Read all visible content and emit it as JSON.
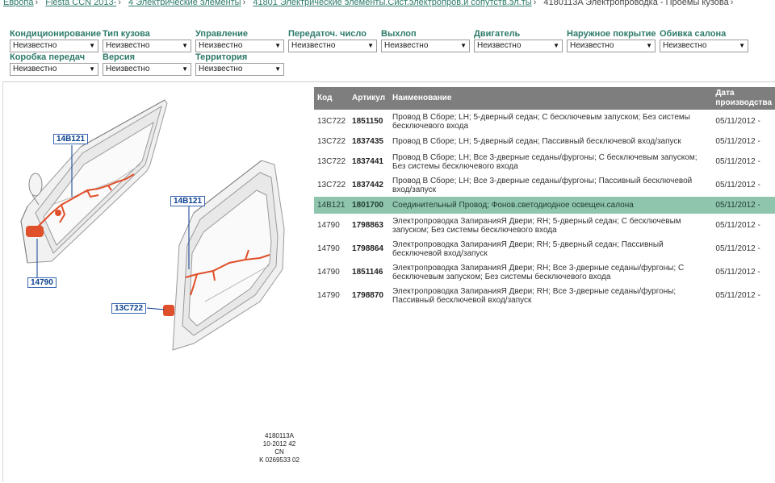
{
  "breadcrumb": [
    {
      "label": "Европа"
    },
    {
      "label": "Fiesta CCN 2013-"
    },
    {
      "label": "4 Электрические элементы"
    },
    {
      "label": "41801 Электрические элементы.Сист.электропров.и сопутств.эл.ты"
    }
  ],
  "breadcrumb_current": "4180113A Электропроводка - Проемы кузова",
  "filters": [
    {
      "label": "Кондиционирование",
      "value": "Неизвестно"
    },
    {
      "label": "Тип кузова",
      "value": "Неизвестно"
    },
    {
      "label": "Управление",
      "value": "Неизвестно"
    },
    {
      "label": "Передаточ. число",
      "value": "Неизвестно"
    },
    {
      "label": "Выхлоп",
      "value": "Неизвестно"
    },
    {
      "label": "Двигатель",
      "value": "Неизвестно"
    },
    {
      "label": "Наружное покрытие",
      "value": "Неизвестно"
    },
    {
      "label": "Обивка салона",
      "value": "Неизвестно"
    },
    {
      "label": "Коробка передач",
      "value": "Неизвестно"
    },
    {
      "label": "Версия",
      "value": "Неизвестно"
    },
    {
      "label": "Территория",
      "value": "Неизвестно"
    }
  ],
  "diagram": {
    "callouts": [
      "14B121",
      "14790",
      "14B121",
      "13C722"
    ],
    "code_lines": [
      "4180113A",
      "10-2012 42",
      "CN",
      "K 0269533 02"
    ],
    "accent": "#e0502a"
  },
  "table": {
    "headers": {
      "code": "Код",
      "article": "Артикул",
      "name": "Наименование",
      "date": "Дата производства"
    },
    "rows": [
      {
        "code": "13C722",
        "article": "1851150",
        "name": "Провод В Сборе; LH; 5-дверный седан; С бесключевым запуском; Без системы бесключевого входа",
        "date": "05/11/2012 -"
      },
      {
        "code": "13C722",
        "article": "1837435",
        "name": "Провод В Сборе; LH; 5-дверный седан; Пассивный бесключевой вход/запуск",
        "date": "05/11/2012 -"
      },
      {
        "code": "13C722",
        "article": "1837441",
        "name": "Провод В Сборе; LH; Все 3-дверные седаны/фургоны; С бесключевым запуском; Без системы бесключевого входа",
        "date": "05/11/2012 -"
      },
      {
        "code": "13C722",
        "article": "1837442",
        "name": "Провод В Сборе; LH; Все 3-дверные седаны/фургоны; Пассивный бесключевой вход/запуск",
        "date": "05/11/2012 -"
      },
      {
        "code": "14B121",
        "article": "1801700",
        "name": "Соединительный Провод; Фонов.светодиодное освещен.салона",
        "date": "05/11/2012 -",
        "highlight": true
      },
      {
        "code": "14790",
        "article": "1798863",
        "name": "Электропроводка ЗапиранияЯ Двери; RH; 5-дверный седан; С бесключевым запуском; Без системы бесключевого входа",
        "date": "05/11/2012 -"
      },
      {
        "code": "14790",
        "article": "1798864",
        "name": "Электропроводка ЗапиранияЯ Двери; RH; 5-дверный седан; Пассивный бесключевой вход/запуск",
        "date": "05/11/2012 -"
      },
      {
        "code": "14790",
        "article": "1851146",
        "name": "Электропроводка ЗапиранияЯ Двери; RH; Все 3-дверные седаны/фургоны; С бесключевым запуском; Без системы бесключевого входа",
        "date": "05/11/2012 -"
      },
      {
        "code": "14790",
        "article": "1798870",
        "name": "Электропроводка ЗапиранияЯ Двери; RH; Все 3-дверные седаны/фургоны; Пассивный бесключевой вход/запуск",
        "date": "05/11/2012 -"
      }
    ]
  }
}
